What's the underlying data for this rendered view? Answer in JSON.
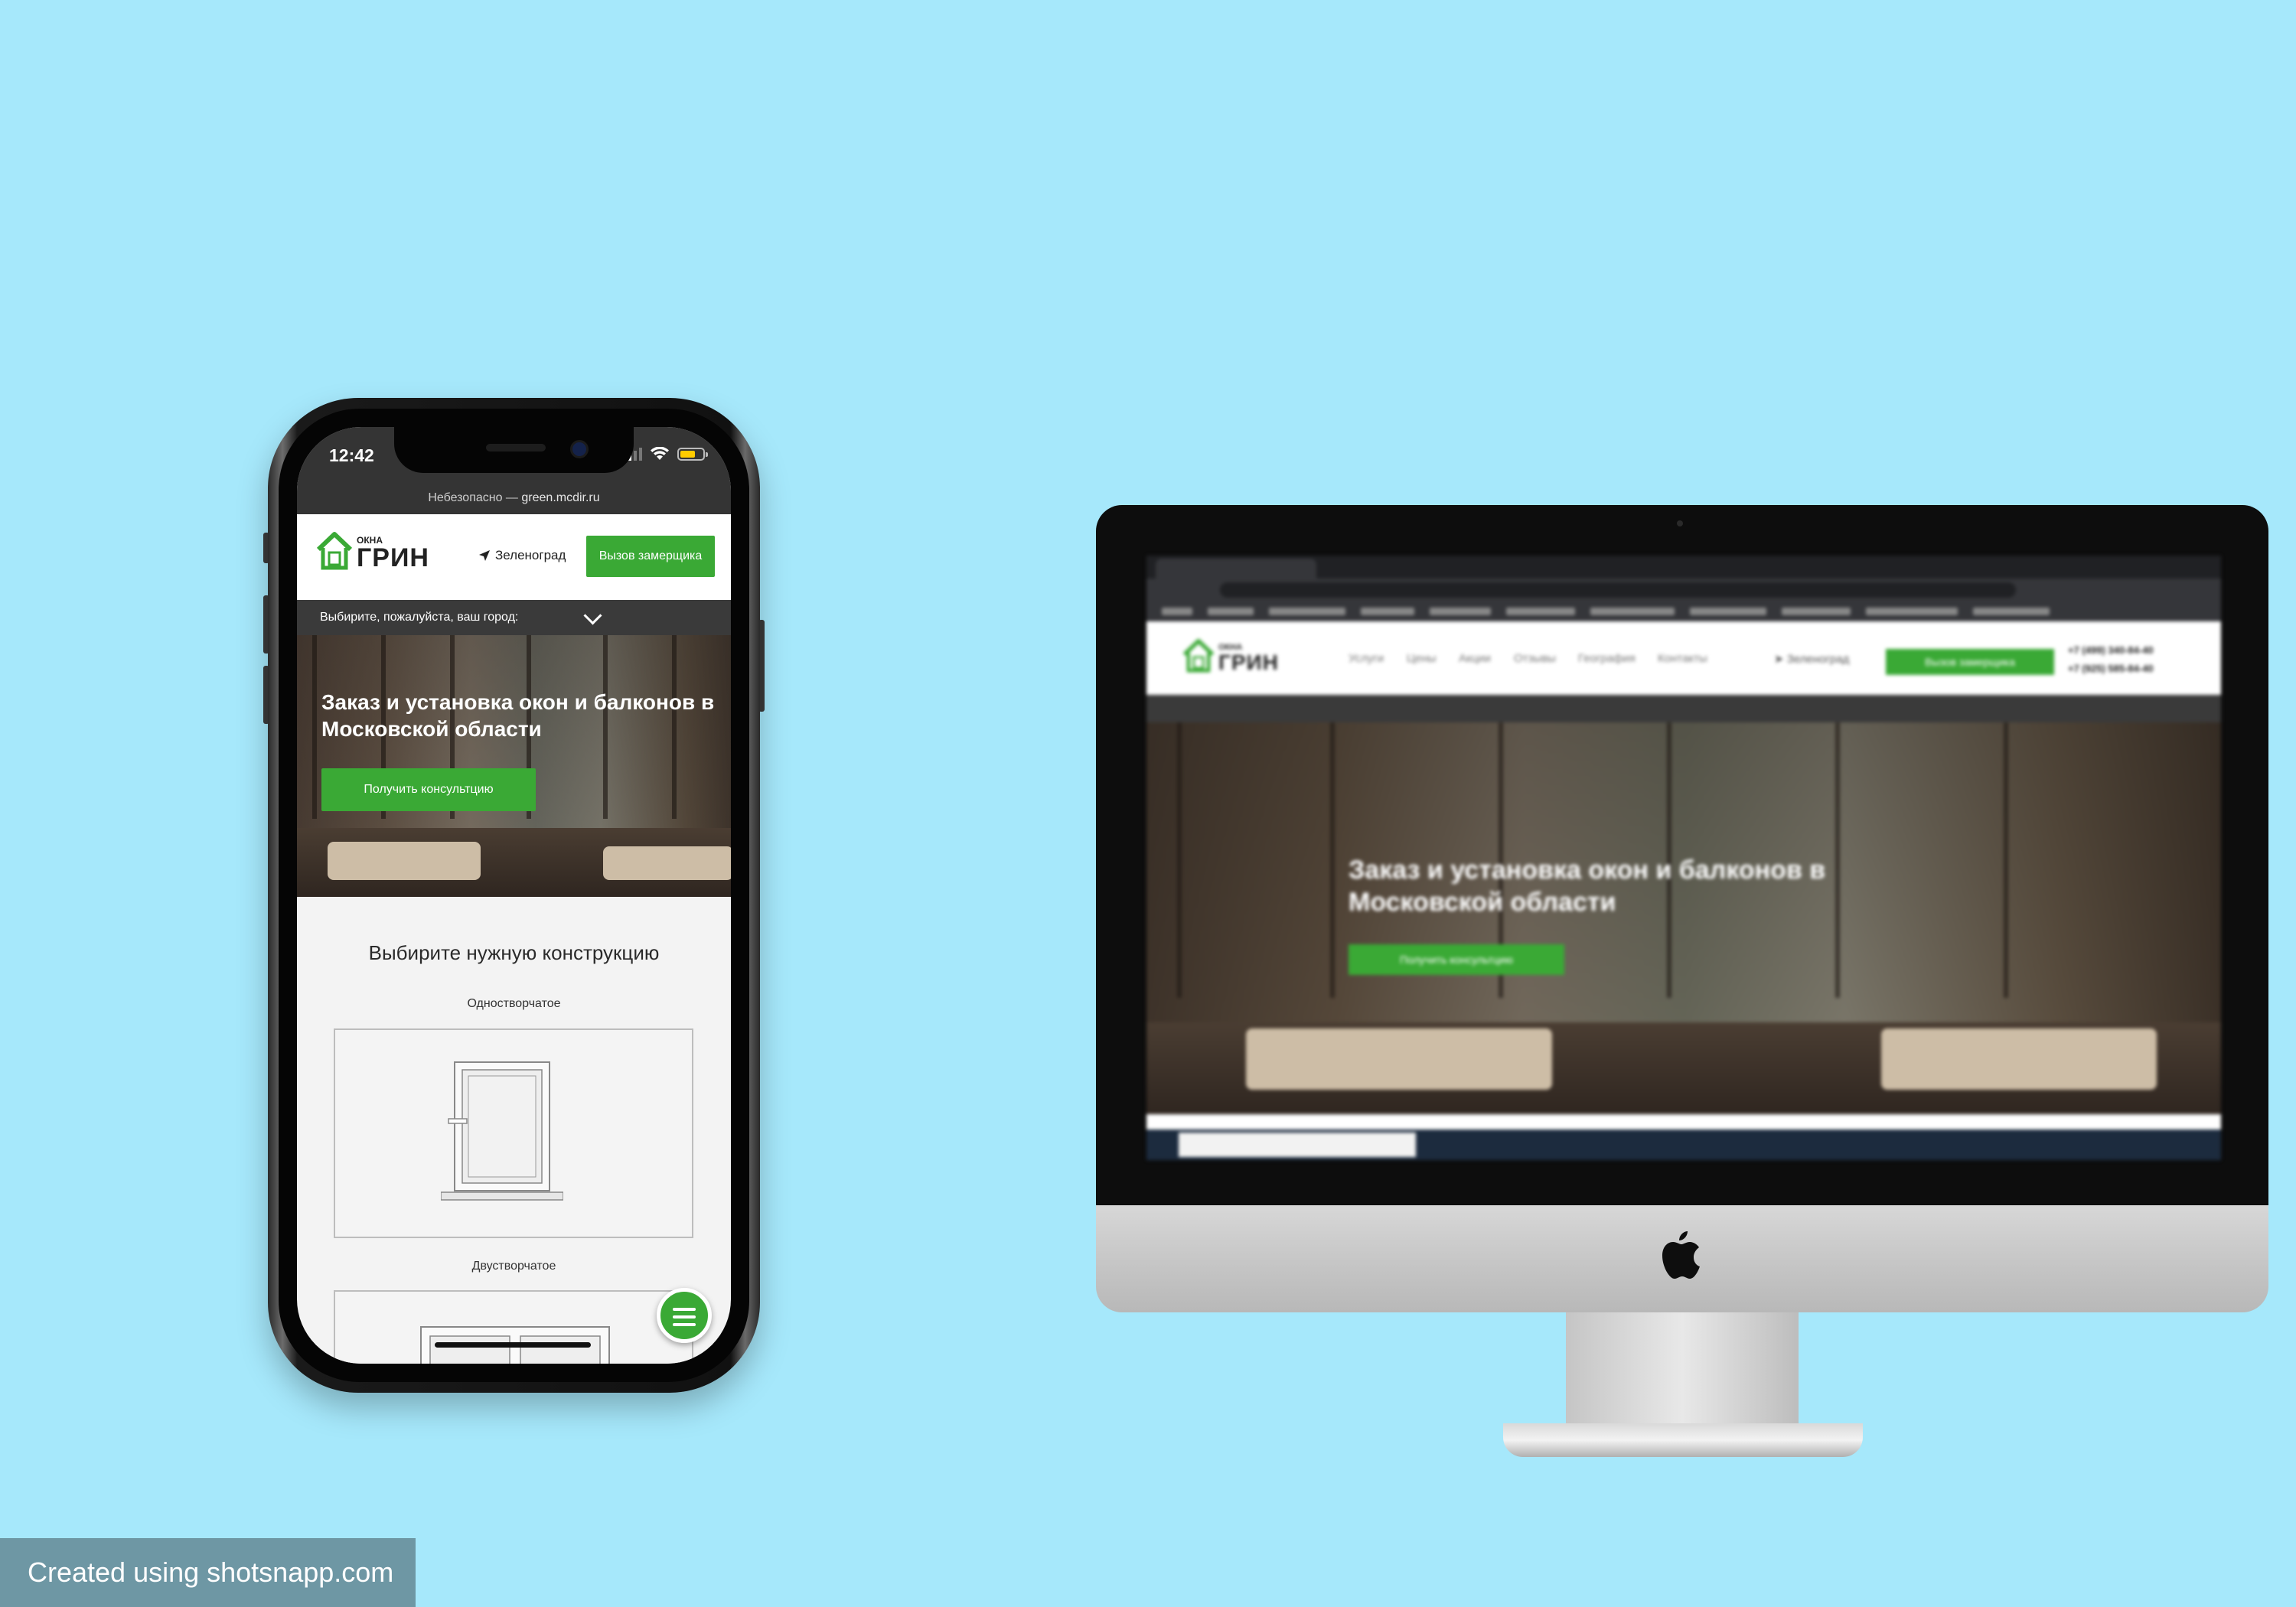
{
  "phone": {
    "status": {
      "time": "12:42"
    },
    "browser": {
      "security": "Небезопасно —",
      "domain": "green.mcdir.ru"
    },
    "header": {
      "logo_small": "ОКНА",
      "logo_big": "ГРИН",
      "city": "Зеленоград",
      "call_button": "Вызов замерщика"
    },
    "city_select": {
      "label": "Выбирите, пожалуйста, ваш город:"
    },
    "hero": {
      "title": "Заказ и установка окон и балконов в Московской области",
      "button": "Получить консультцию"
    },
    "constructions": {
      "title": "Выбирите нужную конструкцию",
      "items": [
        {
          "label": "Одностворчатое"
        },
        {
          "label": "Двустворчатое"
        }
      ]
    },
    "menu_icon": "hamburger-icon"
  },
  "monitor": {
    "site": {
      "logo_small": "ОКНА",
      "logo_big": "ГРИН",
      "nav": [
        "Услуги",
        "Цены",
        "Акции",
        "Отзывы",
        "География",
        "Контакты"
      ],
      "city": "Зеленоград",
      "call_button": "Вызов замерщика",
      "phones": [
        "+7 (499) 340-84-40",
        "+7 (925) 585-84-40"
      ],
      "hero_title": "Заказ и установка окон и балконов в Московской области",
      "hero_button": "Получить консультцию"
    }
  },
  "watermark": "Created using shotsnapp.com",
  "colors": {
    "brand_green": "#3aa935",
    "background": "#a6e8fb",
    "dark_bar": "#3a3a3a"
  }
}
